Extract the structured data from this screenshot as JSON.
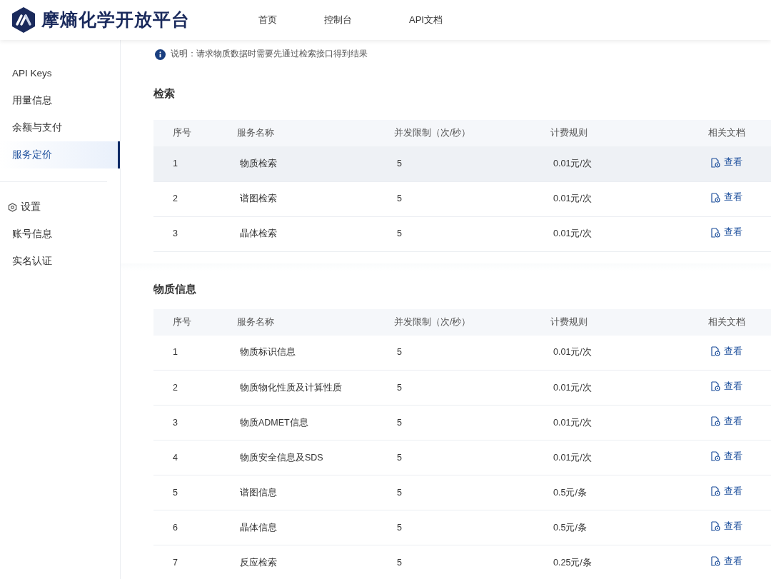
{
  "header": {
    "logo_text": "摩熵化学开放平台",
    "nav": [
      {
        "label": "首页",
        "selected": false
      },
      {
        "label": "控制台",
        "selected": false
      },
      {
        "label": "API文档",
        "selected": false
      }
    ]
  },
  "sidebar": {
    "items": [
      {
        "label": "API Keys",
        "selected": false
      },
      {
        "label": "用量信息",
        "selected": false
      },
      {
        "label": "余额与支付",
        "selected": false
      },
      {
        "label": "服务定价",
        "selected": true
      }
    ],
    "settings_heading": "设置",
    "settings_items": [
      {
        "label": "账号信息",
        "selected": false
      },
      {
        "label": "实名认证",
        "selected": false
      }
    ]
  },
  "notice": "说明：请求物质数据时需要先通过检索接口得到结果",
  "sections": [
    {
      "title": "检索",
      "columns": [
        "序号",
        "服务名称",
        "并发限制（次/秒）",
        "计费规则",
        "相关文档"
      ],
      "rows": [
        {
          "index": "1",
          "name": "物质检索",
          "limit": "5",
          "price": "0.01元/次",
          "doc": "查看",
          "highlighted": true
        },
        {
          "index": "2",
          "name": "谱图检索",
          "limit": "5",
          "price": "0.01元/次",
          "doc": "查看",
          "highlighted": false
        },
        {
          "index": "3",
          "name": "晶体检索",
          "limit": "5",
          "price": "0.01元/次",
          "doc": "查看",
          "highlighted": false
        }
      ]
    },
    {
      "title": "物质信息",
      "columns": [
        "序号",
        "服务名称",
        "并发限制（次/秒）",
        "计费规则",
        "相关文档"
      ],
      "rows": [
        {
          "index": "1",
          "name": "物质标识信息",
          "limit": "5",
          "price": "0.01元/次",
          "doc": "查看",
          "highlighted": false
        },
        {
          "index": "2",
          "name": "物质物化性质及计算性质",
          "limit": "5",
          "price": "0.01元/次",
          "doc": "查看",
          "highlighted": false
        },
        {
          "index": "3",
          "name": "物质ADMET信息",
          "limit": "5",
          "price": "0.01元/次",
          "doc": "查看",
          "highlighted": false
        },
        {
          "index": "4",
          "name": "物质安全信息及SDS",
          "limit": "5",
          "price": "0.01元/次",
          "doc": "查看",
          "highlighted": false
        },
        {
          "index": "5",
          "name": "谱图信息",
          "limit": "5",
          "price": "0.5元/条",
          "doc": "查看",
          "highlighted": false
        },
        {
          "index": "6",
          "name": "晶体信息",
          "limit": "5",
          "price": "0.5元/条",
          "doc": "查看",
          "highlighted": false
        },
        {
          "index": "7",
          "name": "反应检索",
          "limit": "5",
          "price": "0.25元/条",
          "doc": "查看",
          "highlighted": false
        }
      ]
    }
  ]
}
